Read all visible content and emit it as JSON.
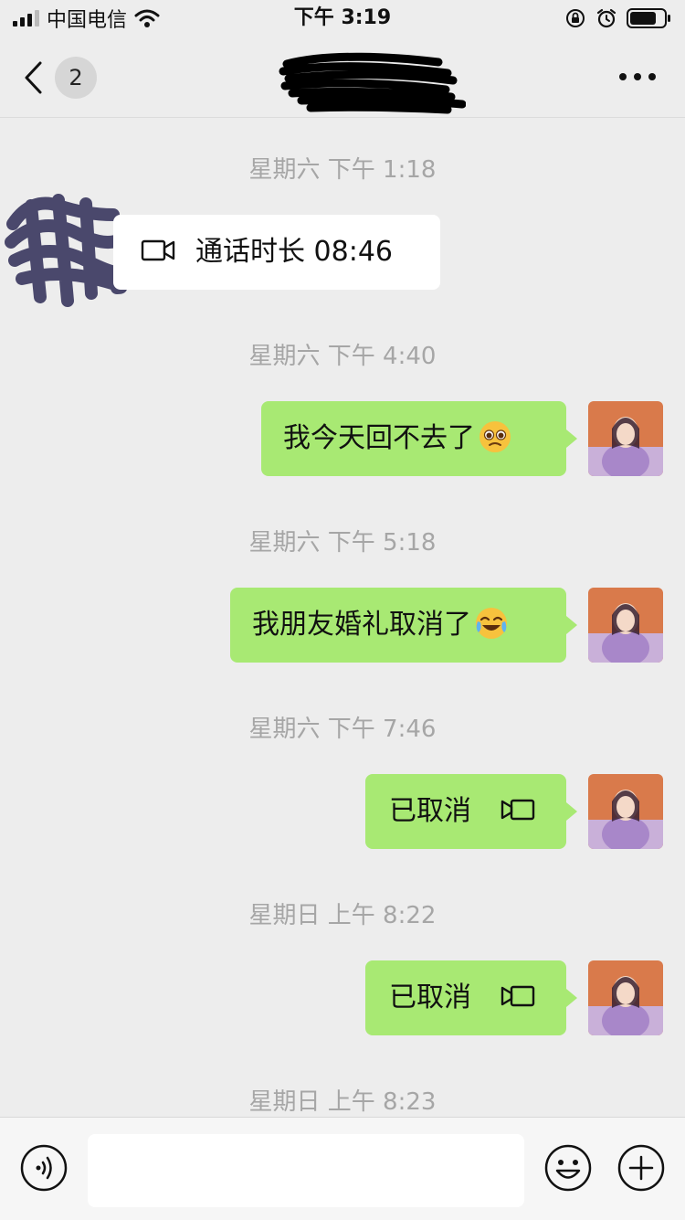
{
  "status_bar": {
    "carrier": "中国电信",
    "time": "下午 3:19"
  },
  "nav": {
    "unread_count": "2"
  },
  "messages": [
    {
      "timestamp": "星期六 下午 1:18",
      "sender": "other",
      "kind": "video-call",
      "text": "通话时长 08:46"
    },
    {
      "timestamp": "星期六 下午 4:40",
      "sender": "me",
      "kind": "text",
      "text": "我今天回不去了",
      "emoji": "pleading-face"
    },
    {
      "timestamp": "星期六 下午 5:18",
      "sender": "me",
      "kind": "text",
      "text": "我朋友婚礼取消了",
      "emoji": "crying-laughing-face"
    },
    {
      "timestamp": "星期六 下午 7:46",
      "sender": "me",
      "kind": "video-call",
      "text": "已取消"
    },
    {
      "timestamp": "星期日 上午 8:22",
      "sender": "me",
      "kind": "video-call",
      "text": "已取消"
    },
    {
      "timestamp": "星期日 上午 8:23"
    }
  ],
  "icons": {
    "back": "chevron-left-icon",
    "more": "more-dots-icon",
    "video_call": "video-camera-icon",
    "voice": "voice-input-icon",
    "emoji": "emoji-icon",
    "plus": "plus-icon"
  },
  "colors": {
    "background": "#ededed",
    "my_bubble": "#a8e973",
    "other_bubble": "#ffffff",
    "timestamp": "#a6a6a6"
  }
}
